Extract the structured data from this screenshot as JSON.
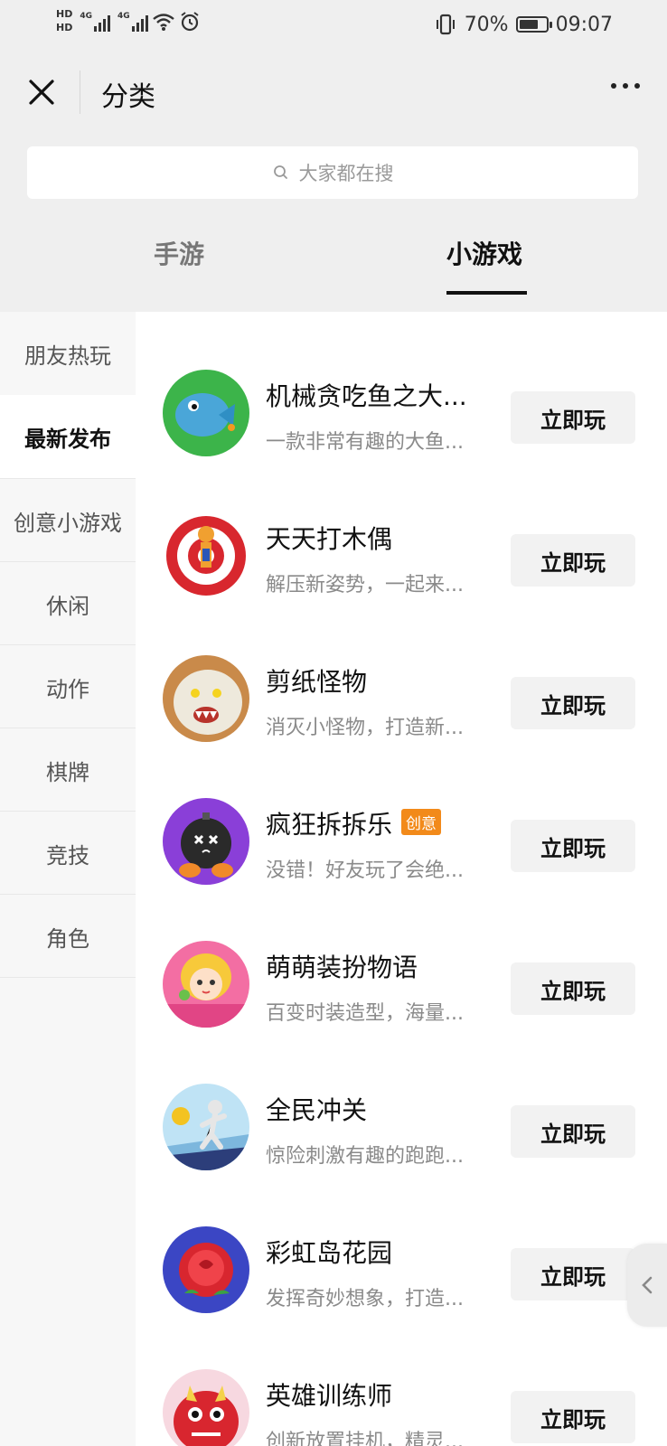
{
  "status_bar": {
    "hd1": "HD",
    "hd2": "HD",
    "net1": "4G",
    "net2": "4G",
    "battery_percent": "70%",
    "time": "09:07",
    "battery_level": 0.7
  },
  "nav": {
    "title": "分类"
  },
  "search": {
    "placeholder": "大家都在搜"
  },
  "tabs": [
    {
      "label": "手游",
      "active": false
    },
    {
      "label": "小游戏",
      "active": true
    }
  ],
  "sidebar": {
    "items": [
      {
        "label": "朋友热玩",
        "active": false
      },
      {
        "label": "最新发布",
        "active": true
      },
      {
        "label": "创意小游戏",
        "active": false
      },
      {
        "label": "休闲",
        "active": false
      },
      {
        "label": "动作",
        "active": false
      },
      {
        "label": "棋牌",
        "active": false
      },
      {
        "label": "竞技",
        "active": false
      },
      {
        "label": "角色",
        "active": false
      }
    ]
  },
  "games": [
    {
      "name": "机械贪吃鱼之大...",
      "desc": "一款非常有趣的大鱼...",
      "button": "立即玩",
      "badge": "",
      "icon": "fish-game-icon"
    },
    {
      "name": "天天打木偶",
      "desc": "解压新姿势，一起来...",
      "button": "立即玩",
      "badge": "",
      "icon": "puppet-game-icon"
    },
    {
      "name": "剪纸怪物",
      "desc": "消灭小怪物，打造新...",
      "button": "立即玩",
      "badge": "",
      "icon": "paper-monster-icon"
    },
    {
      "name": "疯狂拆拆乐",
      "desc": "没错！好友玩了会绝...",
      "button": "立即玩",
      "badge": "创意",
      "icon": "bomb-game-icon"
    },
    {
      "name": "萌萌装扮物语",
      "desc": "百变时装造型，海量...",
      "button": "立即玩",
      "badge": "",
      "icon": "dressup-game-icon"
    },
    {
      "name": "全民冲关",
      "desc": "惊险刺激有趣的跑跑...",
      "button": "立即玩",
      "badge": "",
      "icon": "runner-game-icon"
    },
    {
      "name": "彩虹岛花园",
      "desc": "发挥奇妙想象，打造...",
      "button": "立即玩",
      "badge": "",
      "icon": "rose-game-icon"
    },
    {
      "name": "英雄训练师",
      "desc": "创新放置挂机，精灵...",
      "button": "立即玩",
      "badge": "",
      "icon": "hero-game-icon"
    }
  ],
  "colors": {
    "badge": "#f28a1a",
    "button_bg": "#f2f2f2",
    "header_bg": "#efefef"
  }
}
